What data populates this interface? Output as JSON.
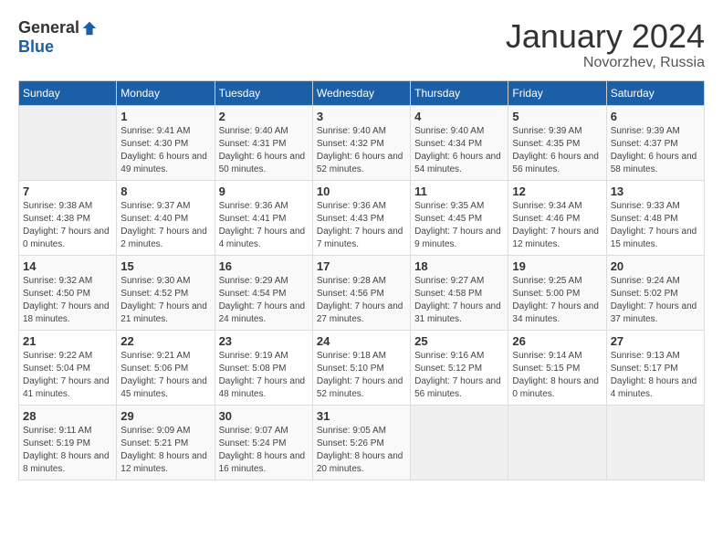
{
  "header": {
    "logo_general": "General",
    "logo_blue": "Blue",
    "month": "January 2024",
    "location": "Novorzhev, Russia"
  },
  "weekdays": [
    "Sunday",
    "Monday",
    "Tuesday",
    "Wednesday",
    "Thursday",
    "Friday",
    "Saturday"
  ],
  "weeks": [
    [
      {
        "day": "",
        "empty": true
      },
      {
        "day": "1",
        "sunrise": "9:41 AM",
        "sunset": "4:30 PM",
        "daylight": "6 hours and 49 minutes."
      },
      {
        "day": "2",
        "sunrise": "9:40 AM",
        "sunset": "4:31 PM",
        "daylight": "6 hours and 50 minutes."
      },
      {
        "day": "3",
        "sunrise": "9:40 AM",
        "sunset": "4:32 PM",
        "daylight": "6 hours and 52 minutes."
      },
      {
        "day": "4",
        "sunrise": "9:40 AM",
        "sunset": "4:34 PM",
        "daylight": "6 hours and 54 minutes."
      },
      {
        "day": "5",
        "sunrise": "9:39 AM",
        "sunset": "4:35 PM",
        "daylight": "6 hours and 56 minutes."
      },
      {
        "day": "6",
        "sunrise": "9:39 AM",
        "sunset": "4:37 PM",
        "daylight": "6 hours and 58 minutes."
      }
    ],
    [
      {
        "day": "7",
        "sunrise": "9:38 AM",
        "sunset": "4:38 PM",
        "daylight": "7 hours and 0 minutes."
      },
      {
        "day": "8",
        "sunrise": "9:37 AM",
        "sunset": "4:40 PM",
        "daylight": "7 hours and 2 minutes."
      },
      {
        "day": "9",
        "sunrise": "9:36 AM",
        "sunset": "4:41 PM",
        "daylight": "7 hours and 4 minutes."
      },
      {
        "day": "10",
        "sunrise": "9:36 AM",
        "sunset": "4:43 PM",
        "daylight": "7 hours and 7 minutes."
      },
      {
        "day": "11",
        "sunrise": "9:35 AM",
        "sunset": "4:45 PM",
        "daylight": "7 hours and 9 minutes."
      },
      {
        "day": "12",
        "sunrise": "9:34 AM",
        "sunset": "4:46 PM",
        "daylight": "7 hours and 12 minutes."
      },
      {
        "day": "13",
        "sunrise": "9:33 AM",
        "sunset": "4:48 PM",
        "daylight": "7 hours and 15 minutes."
      }
    ],
    [
      {
        "day": "14",
        "sunrise": "9:32 AM",
        "sunset": "4:50 PM",
        "daylight": "7 hours and 18 minutes."
      },
      {
        "day": "15",
        "sunrise": "9:30 AM",
        "sunset": "4:52 PM",
        "daylight": "7 hours and 21 minutes."
      },
      {
        "day": "16",
        "sunrise": "9:29 AM",
        "sunset": "4:54 PM",
        "daylight": "7 hours and 24 minutes."
      },
      {
        "day": "17",
        "sunrise": "9:28 AM",
        "sunset": "4:56 PM",
        "daylight": "7 hours and 27 minutes."
      },
      {
        "day": "18",
        "sunrise": "9:27 AM",
        "sunset": "4:58 PM",
        "daylight": "7 hours and 31 minutes."
      },
      {
        "day": "19",
        "sunrise": "9:25 AM",
        "sunset": "5:00 PM",
        "daylight": "7 hours and 34 minutes."
      },
      {
        "day": "20",
        "sunrise": "9:24 AM",
        "sunset": "5:02 PM",
        "daylight": "7 hours and 37 minutes."
      }
    ],
    [
      {
        "day": "21",
        "sunrise": "9:22 AM",
        "sunset": "5:04 PM",
        "daylight": "7 hours and 41 minutes."
      },
      {
        "day": "22",
        "sunrise": "9:21 AM",
        "sunset": "5:06 PM",
        "daylight": "7 hours and 45 minutes."
      },
      {
        "day": "23",
        "sunrise": "9:19 AM",
        "sunset": "5:08 PM",
        "daylight": "7 hours and 48 minutes."
      },
      {
        "day": "24",
        "sunrise": "9:18 AM",
        "sunset": "5:10 PM",
        "daylight": "7 hours and 52 minutes."
      },
      {
        "day": "25",
        "sunrise": "9:16 AM",
        "sunset": "5:12 PM",
        "daylight": "7 hours and 56 minutes."
      },
      {
        "day": "26",
        "sunrise": "9:14 AM",
        "sunset": "5:15 PM",
        "daylight": "8 hours and 0 minutes."
      },
      {
        "day": "27",
        "sunrise": "9:13 AM",
        "sunset": "5:17 PM",
        "daylight": "8 hours and 4 minutes."
      }
    ],
    [
      {
        "day": "28",
        "sunrise": "9:11 AM",
        "sunset": "5:19 PM",
        "daylight": "8 hours and 8 minutes."
      },
      {
        "day": "29",
        "sunrise": "9:09 AM",
        "sunset": "5:21 PM",
        "daylight": "8 hours and 12 minutes."
      },
      {
        "day": "30",
        "sunrise": "9:07 AM",
        "sunset": "5:24 PM",
        "daylight": "8 hours and 16 minutes."
      },
      {
        "day": "31",
        "sunrise": "9:05 AM",
        "sunset": "5:26 PM",
        "daylight": "8 hours and 20 minutes."
      },
      {
        "day": "",
        "empty": true
      },
      {
        "day": "",
        "empty": true
      },
      {
        "day": "",
        "empty": true
      }
    ]
  ]
}
